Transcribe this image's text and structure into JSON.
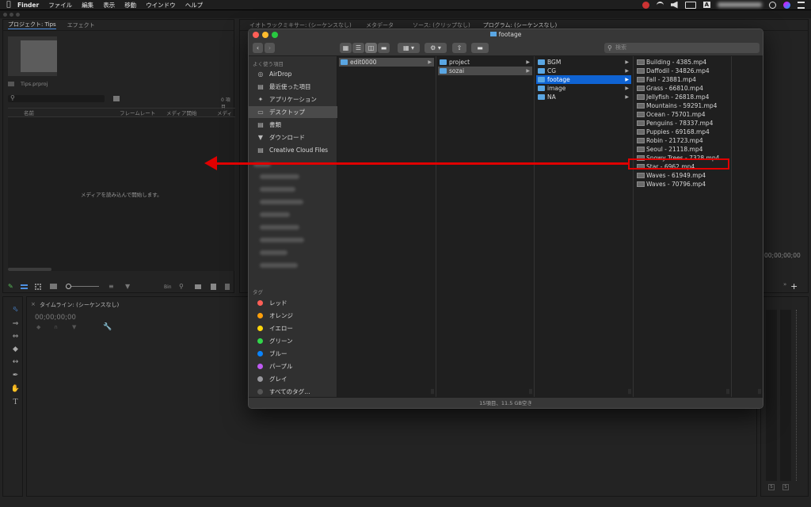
{
  "menubar": {
    "apple_icon": "apple-icon",
    "items": [
      "Finder",
      "ファイル",
      "編集",
      "表示",
      "移動",
      "ウインドウ",
      "ヘルプ"
    ],
    "status_letter": "A"
  },
  "project_panel": {
    "tabs": [
      "プロジェクト: Tips",
      "エフェクト"
    ],
    "project_file": "Tips.prproj",
    "item_count": "0 項目",
    "columns": [
      "名前",
      "フレームレート",
      "メディア開始",
      "メディア"
    ],
    "empty_message": "メディアを読み込んで開始します。",
    "bin_label": "Bin"
  },
  "source_tabs": [
    "イオトラックミキサー: (シーケンスなし)",
    "メタデータ",
    "ソース: (クリップなし)",
    "プログラム: (シーケンスなし)"
  ],
  "program_timecode": "00;00;00;00",
  "timeline": {
    "tab": "タイムライン: (シーケンスなし)",
    "timecode": "00;00;00;00"
  },
  "finder": {
    "title": "footage",
    "search_placeholder": "検索",
    "sidebar": {
      "favorites_header": "よく使う項目",
      "favorites": [
        "AirDrop",
        "最近使った項目",
        "アプリケーション",
        "デスクトップ",
        "書類",
        "ダウンロード",
        "Creative Cloud Files"
      ],
      "tags_header": "タグ",
      "tags": [
        {
          "label": "レッド",
          "color": "#ff5f57"
        },
        {
          "label": "オレンジ",
          "color": "#ff9f0a"
        },
        {
          "label": "イエロー",
          "color": "#ffd60a"
        },
        {
          "label": "グリーン",
          "color": "#32d74b"
        },
        {
          "label": "ブルー",
          "color": "#0a84ff"
        },
        {
          "label": "パープル",
          "color": "#bf5af2"
        },
        {
          "label": "グレイ",
          "color": "#98989d"
        },
        {
          "label": "すべてのタグ…",
          "color": "#555555"
        }
      ]
    },
    "col1": [
      "edit0000"
    ],
    "col2": [
      "project",
      "sozai"
    ],
    "col3": [
      "BGM",
      "CG",
      "footage",
      "image",
      "NA"
    ],
    "files": [
      "Building - 4385.mp4",
      "Daffodil - 34826.mp4",
      "Fall - 23881.mp4",
      "Grass - 66810.mp4",
      "Jellyfish - 26818.mp4",
      "Mountains - 59291.mp4",
      "Ocean - 75701.mp4",
      "Penguins - 78337.mp4",
      "Puppies - 69168.mp4",
      "Robin - 21723.mp4",
      "Seoul - 21118.mp4",
      "Snowy Trees - 7328.mp4",
      "Star - 6962.mp4",
      "Waves - 61949.mp4",
      "Waves - 70796.mp4"
    ],
    "status": "15項目、11.5 GB空き"
  },
  "annotation": {
    "highlight_color": "#e00000",
    "highlighted_file": "Star - 6962.mp4"
  }
}
